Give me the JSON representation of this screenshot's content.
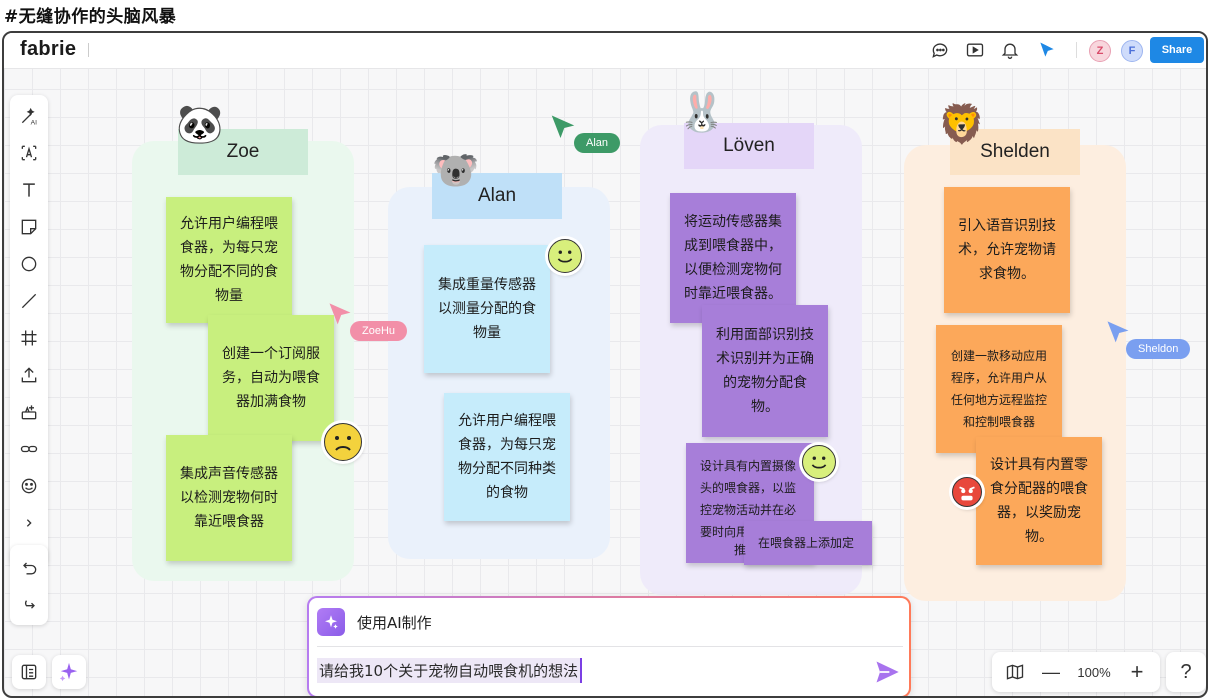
{
  "page_title": "#无缝协作的头脑风暴",
  "app": {
    "logo": "fabrie",
    "topbar_icons": [
      "comment-icon",
      "play-icon",
      "bell-icon",
      "cursor-follow-icon"
    ],
    "avatars": [
      {
        "letter": "Z",
        "bg": "#f8d6dd",
        "fg": "#d94b6a"
      },
      {
        "letter": "F",
        "bg": "#cfdcfb",
        "fg": "#4b6fd9"
      }
    ],
    "share_label": "Share",
    "accent": "#1e88e5"
  },
  "toolbar": {
    "tools": [
      "ai-magic-icon",
      "text-frame-icon",
      "text-icon",
      "sticky-note-icon",
      "circle-icon",
      "line-icon",
      "frame-icon",
      "upload-icon",
      "template-icon",
      "link-icon",
      "emoji-icon",
      "more-icon"
    ],
    "history": [
      "undo-icon",
      "redo-icon"
    ]
  },
  "columns": [
    {
      "name": "Zoe",
      "animal": "🐼",
      "bg": "#eaf8ee",
      "tag_bg": "#cdebd8",
      "notes": [
        "允许用户编程喂食器，为每只宠物分配不同的食物量",
        "创建一个订阅服务，自动为喂食器加满食物",
        "集成声音传感器以检测宠物何时靠近喂食器"
      ],
      "note_color": "#c8ef7e"
    },
    {
      "name": "Alan",
      "animal": "🐨",
      "bg": "#eaf1fb",
      "tag_bg": "#bfe0f8",
      "notes": [
        "集成重量传感器以测量分配的食物量",
        "允许用户编程喂食器，为每只宠物分配不同种类的食物"
      ],
      "note_color": "#c6ecfb"
    },
    {
      "name": "Löven",
      "animal": "🐰",
      "bg": "#efebfa",
      "tag_bg": "#e4d6f8",
      "notes": [
        "将运动传感器集成到喂食器中，以便检测宠物何时靠近喂食器。",
        "利用面部识别技术识别并为正确的宠物分配食物。",
        "设计具有内置摄像头的喂食器，以监控宠物活动并在必要时向用",
        "在喂食器上添加定",
        "推"
      ],
      "note_color": "#a77ed9"
    },
    {
      "name": "Shelden",
      "animal": "🦁",
      "bg": "#fdeee0",
      "tag_bg": "#fbe3c6",
      "notes": [
        "引入语音识别技术，允许宠物请求食物。",
        "创建一款移动应用程序，允许用户从任何地方远程监控和控制喂食器",
        "设计具有内置零食分配器的喂食器，以奖励宠物。"
      ],
      "note_color": "#fca85a"
    }
  ],
  "cursors": [
    {
      "name": "Alan",
      "color": "#3d9a67"
    },
    {
      "name": "ZoeHu",
      "color": "#f28fa8"
    },
    {
      "name": "Sheldon",
      "color": "#7a9ff0"
    }
  ],
  "ai_panel": {
    "title": "使用AI制作",
    "prompt": "请给我10个关于宠物自动喂食机的想法"
  },
  "zoom": {
    "level": "100%",
    "minus": "—",
    "plus": "+"
  },
  "help": "?"
}
